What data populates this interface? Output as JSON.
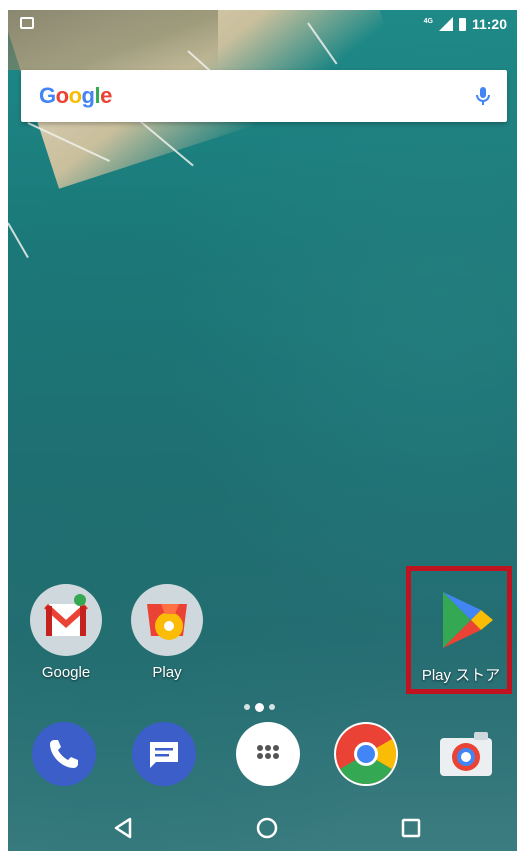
{
  "status_bar": {
    "network": "4G",
    "time": "11:20"
  },
  "search": {
    "logo_letters": [
      "G",
      "o",
      "o",
      "g",
      "l",
      "e"
    ],
    "icon": "mic-icon"
  },
  "home_apps": [
    {
      "label": "Google",
      "icon": "gmail-folder-icon"
    },
    {
      "label": "Play",
      "icon": "play-music-folder-icon"
    },
    {
      "label": "Play ストア",
      "icon": "play-store-icon"
    }
  ],
  "dock": [
    {
      "icon": "phone-icon"
    },
    {
      "icon": "messages-icon"
    },
    {
      "icon": "app-drawer-icon"
    },
    {
      "icon": "chrome-icon"
    },
    {
      "icon": "camera-icon"
    }
  ],
  "navigation": {
    "back": "back-triangle-icon",
    "home": "home-circle-icon",
    "recents": "recents-square-icon"
  },
  "colors": {
    "highlight": "#c1121f",
    "google_blue": "#4285F4",
    "google_red": "#EA4335",
    "google_yellow": "#FBBC05",
    "google_green": "#34A853"
  }
}
